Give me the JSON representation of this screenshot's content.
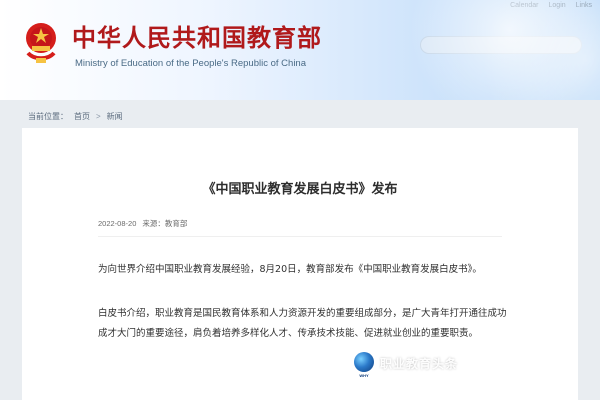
{
  "header": {
    "title_cn": "中华人民共和国教育部",
    "title_en": "Ministry of Education of the People's Republic of China",
    "top_links": [
      "Calendar",
      "Login",
      "Links"
    ],
    "search_placeholder": ""
  },
  "breadcrumb": {
    "label": "当前位置：",
    "items": [
      "首页",
      "新闻"
    ],
    "separator": ">"
  },
  "article": {
    "title": "《中国职业教育发展白皮书》发布",
    "date": "2022-08-20",
    "source": "来源：教育部",
    "para1": "为向世界介绍中国职业教育发展经验，8月20日，教育部发布《中国职业教育发展白皮书》。",
    "para2": "白皮书介绍，职业教育是国民教育体系和人力资源开发的重要组成部分，是广大青年打开通往成功成才大门的重要途径，肩负着培养多样化人才、传承技术技能、促进就业创业的重要职责。"
  },
  "watermark": {
    "logo_text": "WHY",
    "text": "职业教育头条"
  }
}
